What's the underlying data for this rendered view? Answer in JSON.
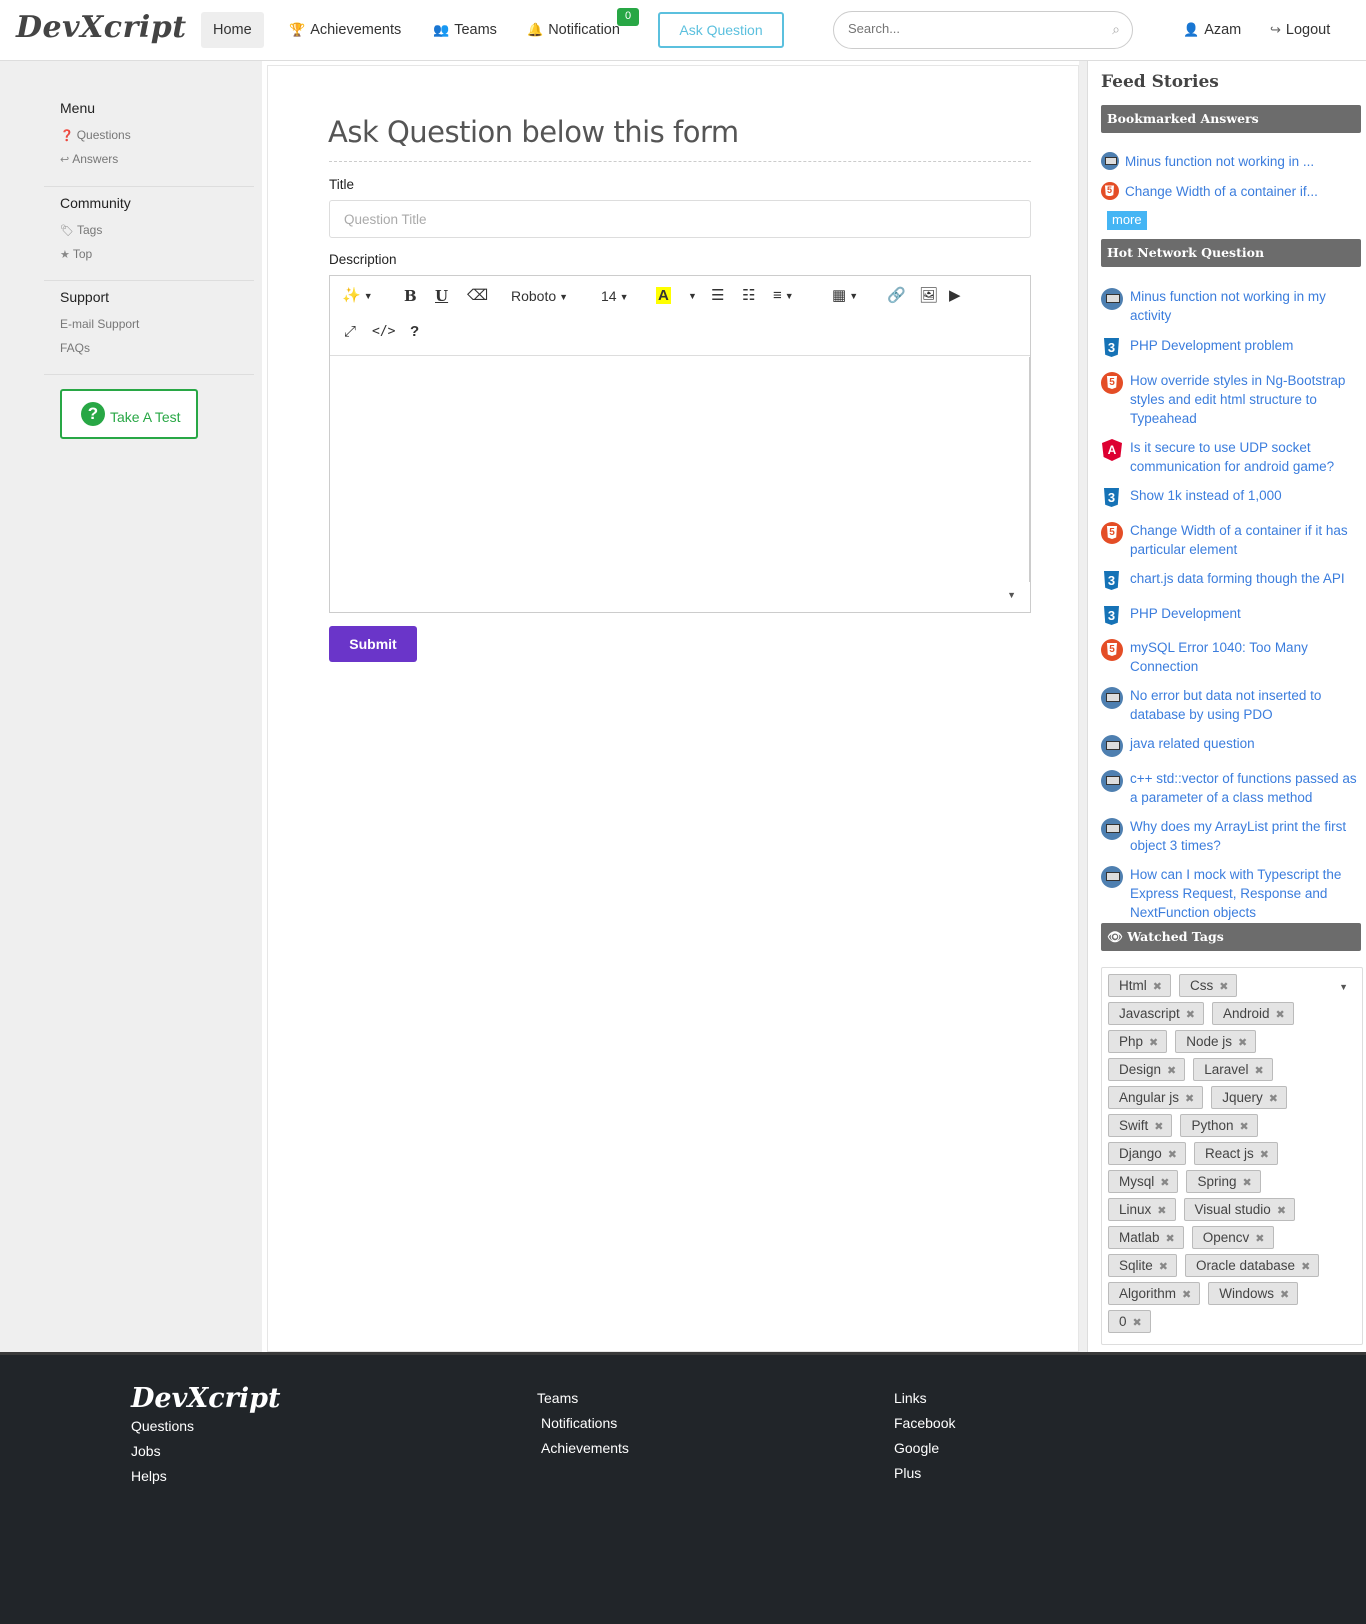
{
  "nav": {
    "logo": "DevXcript",
    "home": "Home",
    "achievements": "Achievements",
    "teams": "Teams",
    "notification": "Notification",
    "notification_count": "0",
    "ask_question": "Ask Question",
    "search_placeholder": "Search...",
    "user": "Azam",
    "logout": "Logout"
  },
  "sidebar": {
    "menu_title": "Menu",
    "questions": "Questions",
    "answers": "Answers",
    "community_title": "Community",
    "tags": "Tags",
    "top": "Top",
    "support_title": "Support",
    "email_support": "E-mail Support",
    "faqs": "FAQs",
    "take_test": "Take A Test"
  },
  "form": {
    "heading": "Ask Question below this form",
    "title_label": "Title",
    "title_placeholder": "Question Title",
    "description_label": "Description",
    "font_family": "Roboto",
    "font_size": "14",
    "submit": "Submit"
  },
  "feed": {
    "title": "Feed Stories",
    "bookmarked_title": "Bookmarked Answers",
    "bookmarked": [
      {
        "text": "Minus function not working in ...",
        "icon": "desktop-icon"
      },
      {
        "text": "Change Width of a container if...",
        "icon": "html5-icon"
      }
    ],
    "more": "more",
    "hot_title": "Hot Network Question",
    "hot": [
      {
        "text": "Minus function not working in my activity",
        "icon": "desktop-icon"
      },
      {
        "text": "PHP Development problem",
        "icon": "css3-icon"
      },
      {
        "text": "How override styles in Ng-Bootstrap styles and edit html structure to Typeahead",
        "icon": "html5-icon"
      },
      {
        "text": "Is it secure to use UDP socket communication for android game?",
        "icon": "angular-icon"
      },
      {
        "text": "Show 1k instead of 1,000",
        "icon": "css3-icon"
      },
      {
        "text": "Change Width of a container if it has particular element",
        "icon": "html5-icon"
      },
      {
        "text": "chart.js data forming though the API",
        "icon": "css3-icon"
      },
      {
        "text": "PHP Development",
        "icon": "css3-icon"
      },
      {
        "text": "mySQL Error 1040: Too Many Connection",
        "icon": "html5-icon"
      },
      {
        "text": "No error but data not inserted to database by using PDO",
        "icon": "desktop-icon"
      },
      {
        "text": "java related question",
        "icon": "desktop-icon"
      },
      {
        "text": "c++ std::vector of functions passed as a parameter of a class method",
        "icon": "desktop-icon"
      },
      {
        "text": "Why does my ArrayList print the first object 3 times?",
        "icon": "desktop-icon"
      },
      {
        "text": "How can I mock with Typescript the Express Request, Response and NextFunction objects",
        "icon": "desktop-icon"
      }
    ],
    "watched_title": "Watched Tags",
    "tag_rows": [
      [
        "Html",
        "Css"
      ],
      [
        "Javascript",
        "Android"
      ],
      [
        "Php",
        "Node js"
      ],
      [
        "Design",
        "Laravel"
      ],
      [
        "Angular js",
        "Jquery"
      ],
      [
        "Swift",
        "Python"
      ],
      [
        "Django",
        "React js"
      ],
      [
        "Mysql",
        "Spring"
      ],
      [
        "Linux",
        "Visual studio"
      ],
      [
        "Matlab",
        "Opencv"
      ],
      [
        "Sqlite",
        "Oracle database"
      ],
      [
        "Algorithm",
        "Windows"
      ],
      [
        "0"
      ]
    ]
  },
  "footer": {
    "logo": "DevXcript",
    "col1": [
      "Questions",
      "Jobs",
      "Helps"
    ],
    "col2": [
      "Teams",
      "Notifications",
      "Achievements"
    ],
    "col3": [
      "Links",
      "Facebook",
      "Google",
      "Plus"
    ]
  }
}
